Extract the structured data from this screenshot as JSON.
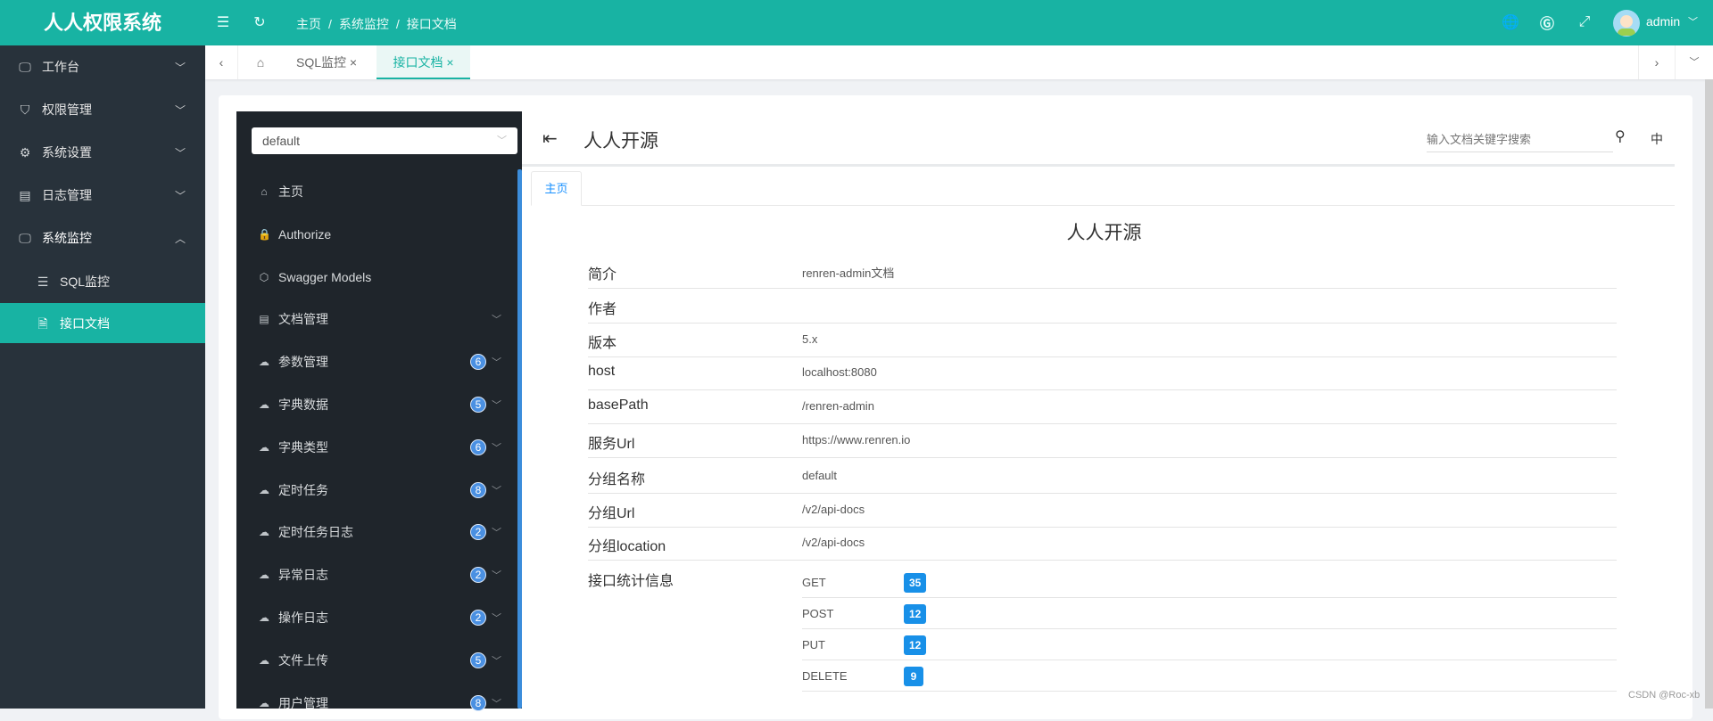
{
  "app": {
    "title": "人人权限系统",
    "breadcrumb": [
      "主页",
      "/",
      "系统监控",
      "/",
      "接口文档"
    ],
    "user": "admin"
  },
  "sidebar": {
    "items": [
      {
        "label": "工作台",
        "icon": "monitor-icon"
      },
      {
        "label": "权限管理",
        "icon": "shield-icon"
      },
      {
        "label": "系统设置",
        "icon": "gear-icon"
      },
      {
        "label": "日志管理",
        "icon": "log-icon"
      },
      {
        "label": "系统监控",
        "icon": "monitor-icon"
      }
    ],
    "sub": [
      {
        "label": "SQL监控"
      },
      {
        "label": "接口文档"
      }
    ]
  },
  "tabs": [
    {
      "label": "SQL监控",
      "close": "×"
    },
    {
      "label": "接口文档",
      "close": "×"
    }
  ],
  "docnav": {
    "group": "default",
    "items": [
      {
        "label": "主页",
        "icon": "⌂"
      },
      {
        "label": "Authorize",
        "icon": "🔒"
      },
      {
        "label": "Swagger Models",
        "icon": "⬡"
      },
      {
        "label": "文档管理",
        "icon": "▤",
        "chevron": true
      },
      {
        "label": "参数管理",
        "badge": "6"
      },
      {
        "label": "字典数据",
        "badge": "5"
      },
      {
        "label": "字典类型",
        "badge": "6"
      },
      {
        "label": "定时任务",
        "badge": "8"
      },
      {
        "label": "定时任务日志",
        "badge": "2"
      },
      {
        "label": "异常日志",
        "badge": "2"
      },
      {
        "label": "操作日志",
        "badge": "2"
      },
      {
        "label": "文件上传",
        "badge": "5"
      },
      {
        "label": "用户管理",
        "badge": "8"
      }
    ]
  },
  "doc": {
    "title": "人人开源",
    "search_placeholder": "输入文档关键字搜索",
    "lang": "中",
    "tab": "主页",
    "heading": "人人开源",
    "rows": [
      {
        "label": "简介",
        "value": "renren-admin文档"
      },
      {
        "label": "作者",
        "value": ""
      },
      {
        "label": "版本",
        "value": "5.x"
      },
      {
        "label": "host",
        "value": "localhost:8080"
      },
      {
        "label": "basePath",
        "value": "/renren-admin"
      },
      {
        "label": "服务Url",
        "value": "https://www.renren.io"
      },
      {
        "label": "分组名称",
        "value": "default"
      },
      {
        "label": "分组Url",
        "value": "/v2/api-docs"
      },
      {
        "label": "分组location",
        "value": "/v2/api-docs"
      }
    ],
    "stats_label": "接口统计信息",
    "stats": [
      {
        "method": "GET",
        "count": "35"
      },
      {
        "method": "POST",
        "count": "12"
      },
      {
        "method": "PUT",
        "count": "12"
      },
      {
        "method": "DELETE",
        "count": "9"
      }
    ]
  },
  "watermark": "CSDN @Roc-xb"
}
